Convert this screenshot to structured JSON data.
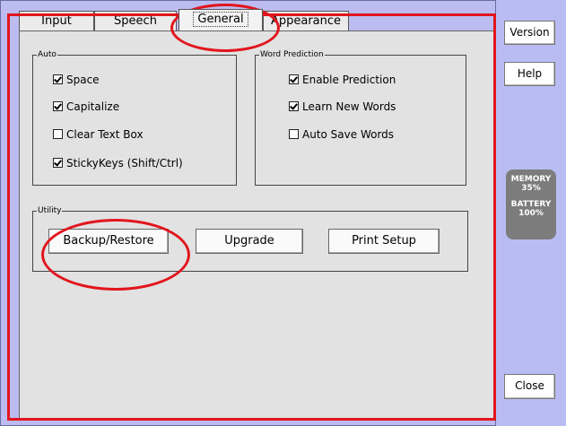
{
  "tabs": [
    "Input",
    "Speech",
    "General",
    "Appearance"
  ],
  "active_tab": "General",
  "auto": {
    "legend": "Auto",
    "items": [
      {
        "label": "Space",
        "checked": true
      },
      {
        "label": "Capitalize",
        "checked": true
      },
      {
        "label": "Clear Text Box",
        "checked": false
      },
      {
        "label": "StickyKeys (Shift/Ctrl)",
        "checked": true
      }
    ]
  },
  "word_prediction": {
    "legend": "Word Prediction",
    "items": [
      {
        "label": "Enable Prediction",
        "checked": true
      },
      {
        "label": "Learn New Words",
        "checked": true
      },
      {
        "label": "Auto Save Words",
        "checked": false
      }
    ]
  },
  "utility": {
    "legend": "Utility",
    "buttons": [
      "Backup/Restore",
      "Upgrade",
      "Print Setup"
    ]
  },
  "side": {
    "version": "Version",
    "help": "Help",
    "close": "Close",
    "memory_label": "MEMORY",
    "memory_value": "35%",
    "battery_label": "BATTERY",
    "battery_value": "100%"
  },
  "colors": {
    "highlight": "#e2151d",
    "panel": "#e2e2e2",
    "sidebar": "#b9bcf2"
  }
}
